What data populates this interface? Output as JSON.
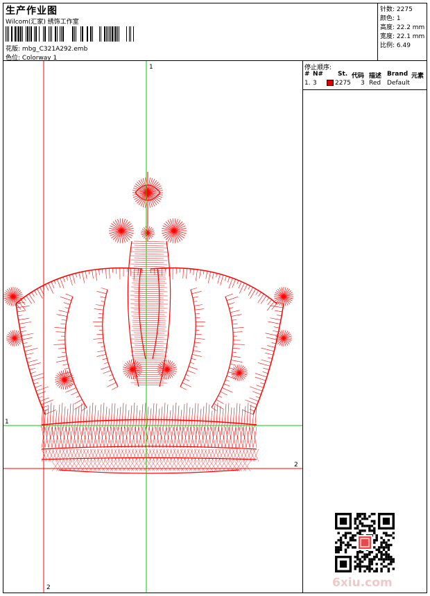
{
  "header": {
    "title": "生产作业图",
    "company": "Wilcom(汇家) 绣饰工作室",
    "design_label": "花版:",
    "design_file": "mbg_C321A292.emb",
    "colorway_label": "色位:",
    "colorway": "Colorway 1"
  },
  "stats": {
    "stitches": "针数: 2275",
    "colors": "颜色: 1",
    "height": "高度: 22.2 mm",
    "width": "宽度: 22.1 mm",
    "scale": "比例: 6.49"
  },
  "stop_sequence": {
    "title": "停止顺序:",
    "headers": [
      "#",
      "N#",
      "St.",
      "代码",
      "描述",
      "Brand",
      "元素"
    ],
    "rows": [
      {
        "index": "1.",
        "needle": "3",
        "stitches": "2275",
        "code": "3",
        "desc": "Red",
        "brand": "Default",
        "color": "#e00000"
      }
    ]
  },
  "axis_labels": {
    "green_v": "1",
    "green_h": "1",
    "red_v": "2",
    "red_h": "2"
  },
  "watermark": "6xiu.com",
  "colors": {
    "thread": "#ff0000",
    "green_guide": "#00cc00",
    "red_guide": "#ff0000",
    "watermark": "#f0c8c8"
  }
}
